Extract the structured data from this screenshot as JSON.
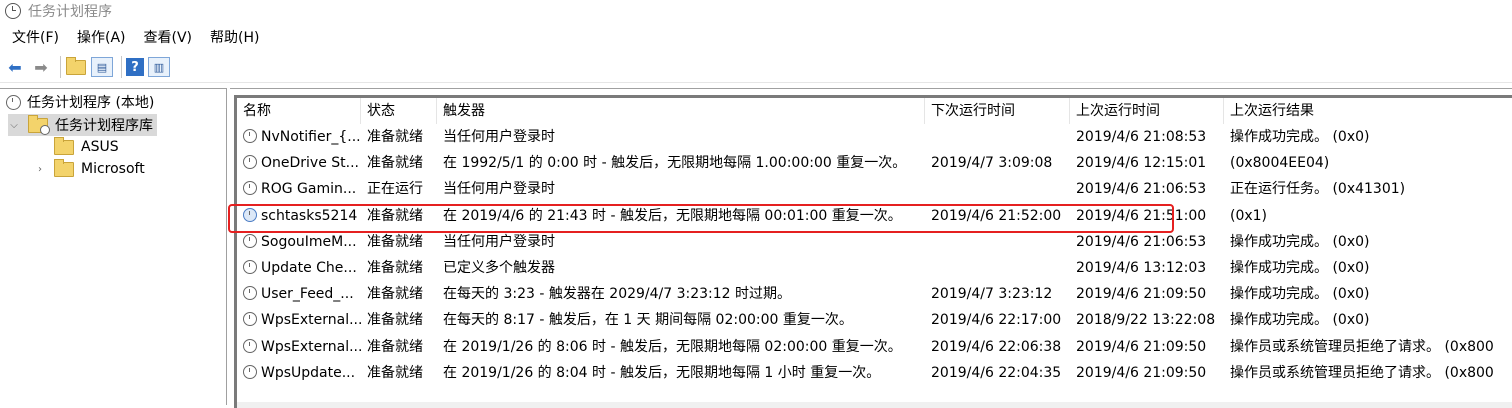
{
  "app": {
    "title": "任务计划程序"
  },
  "menu": [
    "文件(F)",
    "操作(A)",
    "查看(V)",
    "帮助(H)"
  ],
  "toolbar": {
    "icons": [
      "back-arrow-icon",
      "forward-arrow-icon",
      "folder-up-icon",
      "show-hide-tree-icon",
      "help-icon",
      "show-hide-action-pane-icon"
    ]
  },
  "tree": {
    "root": "任务计划程序 (本地)",
    "library": "任务计划程序库",
    "children": [
      "ASUS",
      "Microsoft"
    ]
  },
  "table": {
    "columns": [
      "名称",
      "状态",
      "触发器",
      "下次运行时间",
      "上次运行时间",
      "上次运行结果"
    ],
    "rows": [
      [
        "NvNotifier_{...",
        "准备就绪",
        "当任何用户登录时",
        "",
        "2019/4/6 21:08:53",
        "操作成功完成。 (0x0)"
      ],
      [
        "OneDrive St...",
        "准备就绪",
        "在 1992/5/1 的 0:00 时 - 触发后，无限期地每隔 1.00:00:00 重复一次。",
        "2019/4/7 3:09:08",
        "2019/4/6 12:15:01",
        "(0x8004EE04)"
      ],
      [
        "ROG Gamin...",
        "正在运行",
        "当任何用户登录时",
        "",
        "2019/4/6 21:06:53",
        "正在运行任务。 (0x41301)"
      ],
      [
        "schtasks5214",
        "准备就绪",
        "在 2019/4/6 的 21:43 时 - 触发后，无限期地每隔 00:01:00 重复一次。",
        "2019/4/6 21:52:00",
        "2019/4/6 21:51:00",
        "(0x1)"
      ],
      [
        "SogouImeM...",
        "准备就绪",
        "当任何用户登录时",
        "",
        "2019/4/6 21:06:53",
        "操作成功完成。 (0x0)"
      ],
      [
        "Update Che...",
        "准备就绪",
        "已定义多个触发器",
        "",
        "2019/4/6 13:12:03",
        "操作成功完成。 (0x0)"
      ],
      [
        "User_Feed_...",
        "准备就绪",
        "在每天的 3:23 - 触发器在 2029/4/7 3:23:12 时过期。",
        "2019/4/7 3:23:12",
        "2019/4/6 21:09:50",
        "操作成功完成。 (0x0)"
      ],
      [
        "WpsExternal...",
        "准备就绪",
        "在每天的 8:17 - 触发后，在 1 天 期间每隔 02:00:00 重复一次。",
        "2019/4/6 22:17:00",
        "2018/9/22 13:22:08",
        "操作成功完成。 (0x0)"
      ],
      [
        "WpsExternal...",
        "准备就绪",
        "在 2019/1/26 的 8:06 时 - 触发后，无限期地每隔 02:00:00 重复一次。",
        "2019/4/6 22:06:38",
        "2019/4/6 21:09:50",
        "操作员或系统管理员拒绝了请求。 (0x800"
      ],
      [
        "WpsUpdate...",
        "准备就绪",
        "在 2019/1/26 的 8:04 时 - 触发后，无限期地每隔 1 小时 重复一次。",
        "2019/4/6 22:04:35",
        "2019/4/6 21:09:50",
        "操作员或系统管理员拒绝了请求。 (0x800"
      ]
    ],
    "highlighted_row": 3,
    "highlight_color": "#e52020"
  }
}
